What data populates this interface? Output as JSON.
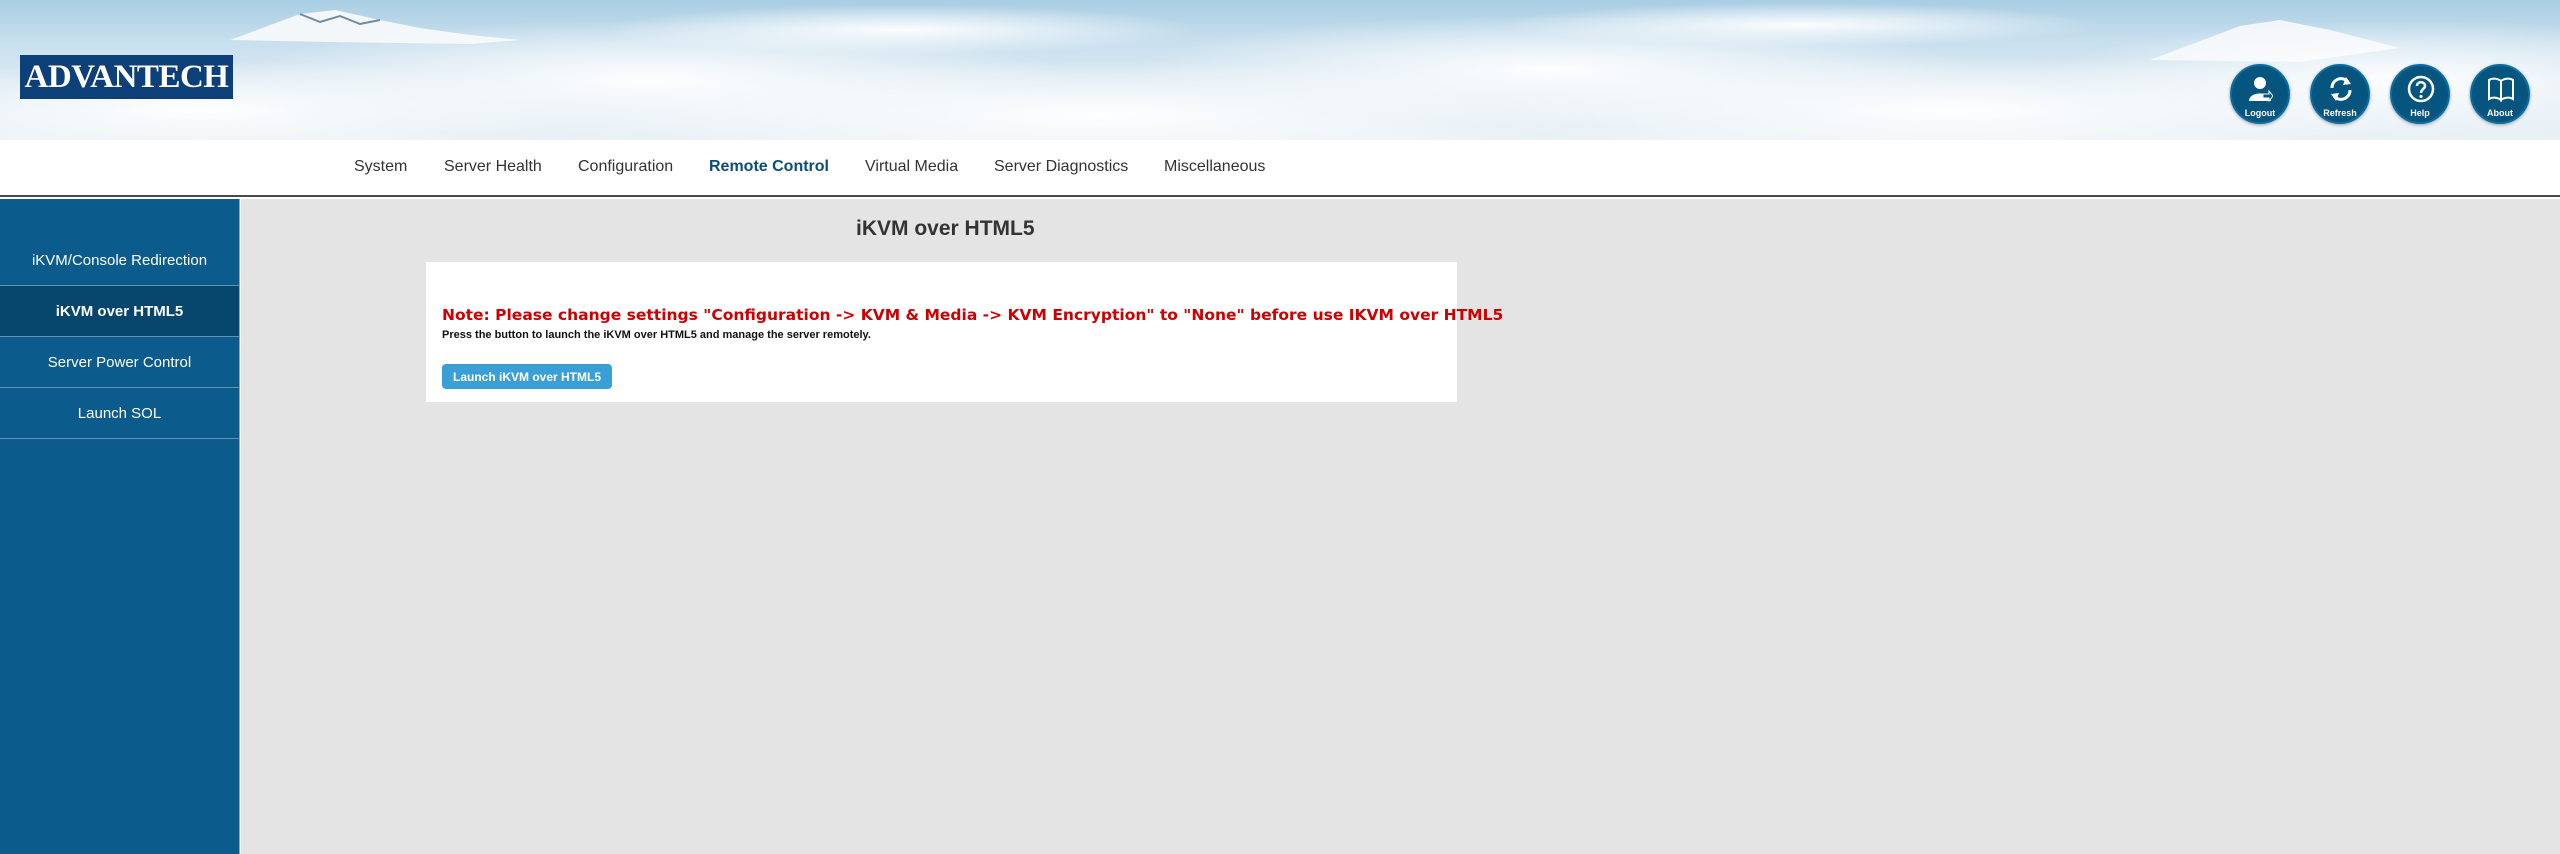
{
  "brand": {
    "logo_text": "ADVANTECH"
  },
  "header_buttons": [
    {
      "label": "Logout",
      "icon": "user-icon"
    },
    {
      "label": "Refresh",
      "icon": "refresh-icon"
    },
    {
      "label": "Help",
      "icon": "help-icon"
    },
    {
      "label": "About",
      "icon": "book-icon"
    }
  ],
  "nav": {
    "items": [
      "System",
      "Server Health",
      "Configuration",
      "Remote Control",
      "Virtual Media",
      "Server Diagnostics",
      "Miscellaneous"
    ],
    "active": "Remote Control"
  },
  "sidebar": {
    "items": [
      "iKVM/Console Redirection",
      "iKVM over HTML5",
      "Server Power Control",
      "Launch SOL"
    ],
    "active": "iKVM over HTML5"
  },
  "main": {
    "title": "iKVM over HTML5",
    "note": "Note: Please change settings \"Configuration -> KVM & Media -> KVM Encryption\" to \"None\" before use IKVM over HTML5",
    "description": "Press the button to launch the iKVM over HTML5 and manage the server remotely.",
    "launch_button": "Launch iKVM over HTML5"
  },
  "colors": {
    "sidebar_bg": "#0b5b8c",
    "sidebar_active": "#06466c",
    "nav_active": "#0b4d7a",
    "note_red": "#cc0000",
    "button_blue": "#3a9fd6",
    "logo_bg": "#0d3f78"
  }
}
